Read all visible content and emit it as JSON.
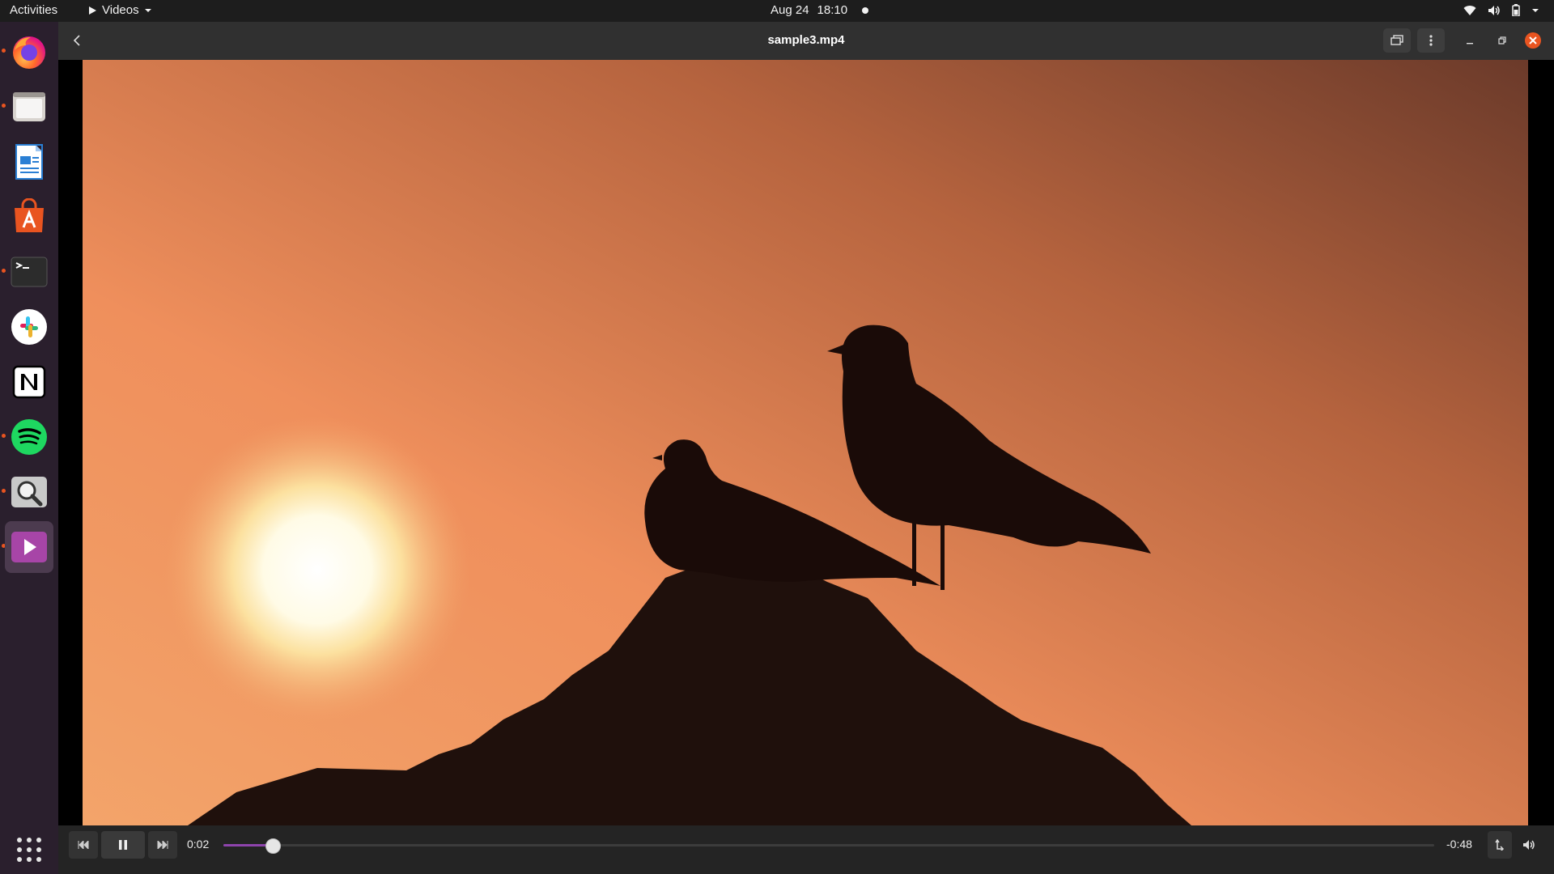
{
  "topbar": {
    "activities": "Activities",
    "app_name": "Videos",
    "date": "Aug 24",
    "time": "18:10"
  },
  "dock": {
    "items": [
      {
        "name": "firefox",
        "icon": "firefox-icon",
        "running": true
      },
      {
        "name": "files",
        "icon": "folder-icon",
        "running": true
      },
      {
        "name": "writer",
        "icon": "document-icon",
        "running": false
      },
      {
        "name": "software",
        "icon": "store-icon",
        "running": false
      },
      {
        "name": "terminal",
        "icon": "terminal-icon",
        "running": true
      },
      {
        "name": "slack",
        "icon": "slack-icon",
        "running": false
      },
      {
        "name": "notion",
        "icon": "notion-icon",
        "running": false
      },
      {
        "name": "spotify",
        "icon": "spotify-icon",
        "running": true
      },
      {
        "name": "image-viewer",
        "icon": "magnifier-icon",
        "running": true
      },
      {
        "name": "videos",
        "icon": "play-icon",
        "running": true,
        "active": true
      }
    ],
    "show_apps_icon": "grid-icon"
  },
  "window": {
    "title": "sample3.mp4"
  },
  "player": {
    "elapsed": "0:02",
    "remaining": "-0:48",
    "progress_fraction": 0.04,
    "state": "playing"
  },
  "colors": {
    "accent": "#8e44ad",
    "close": "#e95420",
    "panel": "#1d1d1d",
    "dock": "#2a1f2d"
  }
}
